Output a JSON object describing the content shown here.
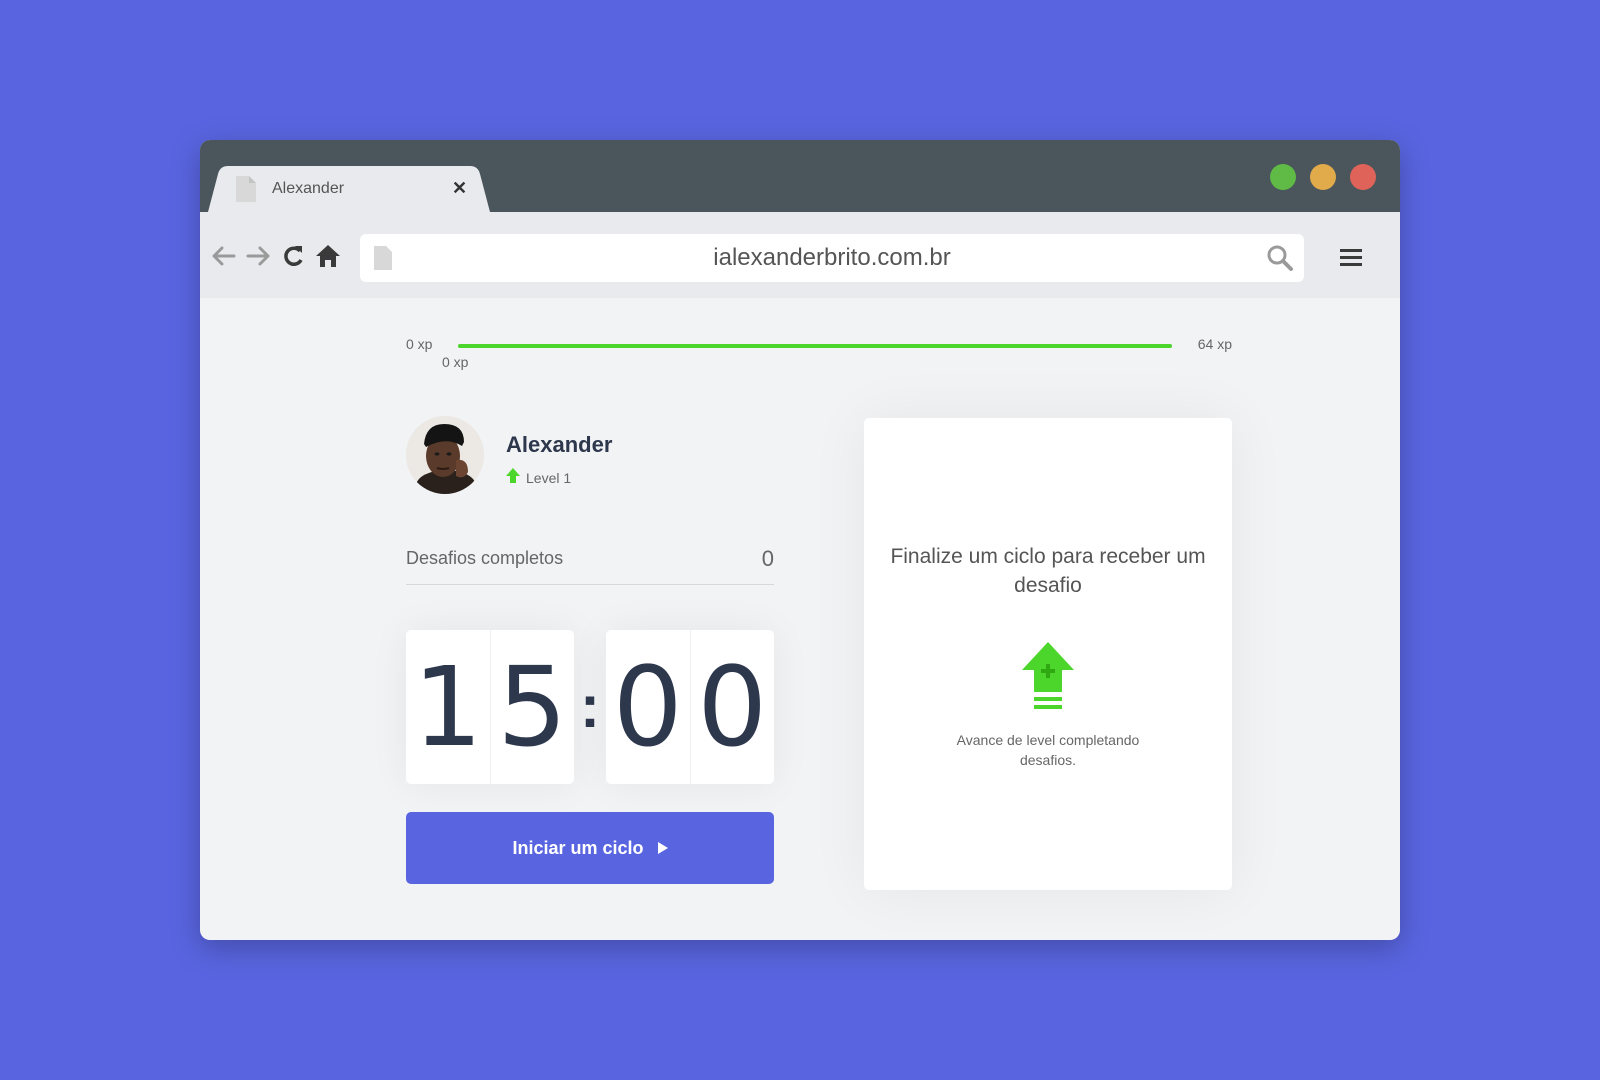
{
  "browser": {
    "tab_title": "Alexander",
    "url": "ialexanderbrito.com.br"
  },
  "xp": {
    "min_label": "0 xp",
    "max_label": "64 xp",
    "current_label": "0 xp",
    "progress_percent": 100
  },
  "profile": {
    "name": "Alexander",
    "level_label": "Level 1"
  },
  "stats": {
    "completed_label": "Desafios completos",
    "completed_value": "0"
  },
  "countdown": {
    "minute_left": "1",
    "minute_right": "5",
    "separator": ":",
    "second_left": "0",
    "second_right": "0"
  },
  "cycle_button": {
    "label": "Iniciar um ciclo"
  },
  "challenge_box": {
    "title": "Finalize um ciclo para receber um desafio",
    "description": "Avance de level completando desafios."
  },
  "colors": {
    "background": "#5965E0",
    "accent_green": "#4CD62B",
    "button": "#5965E0",
    "text_dark": "#2E384D"
  }
}
